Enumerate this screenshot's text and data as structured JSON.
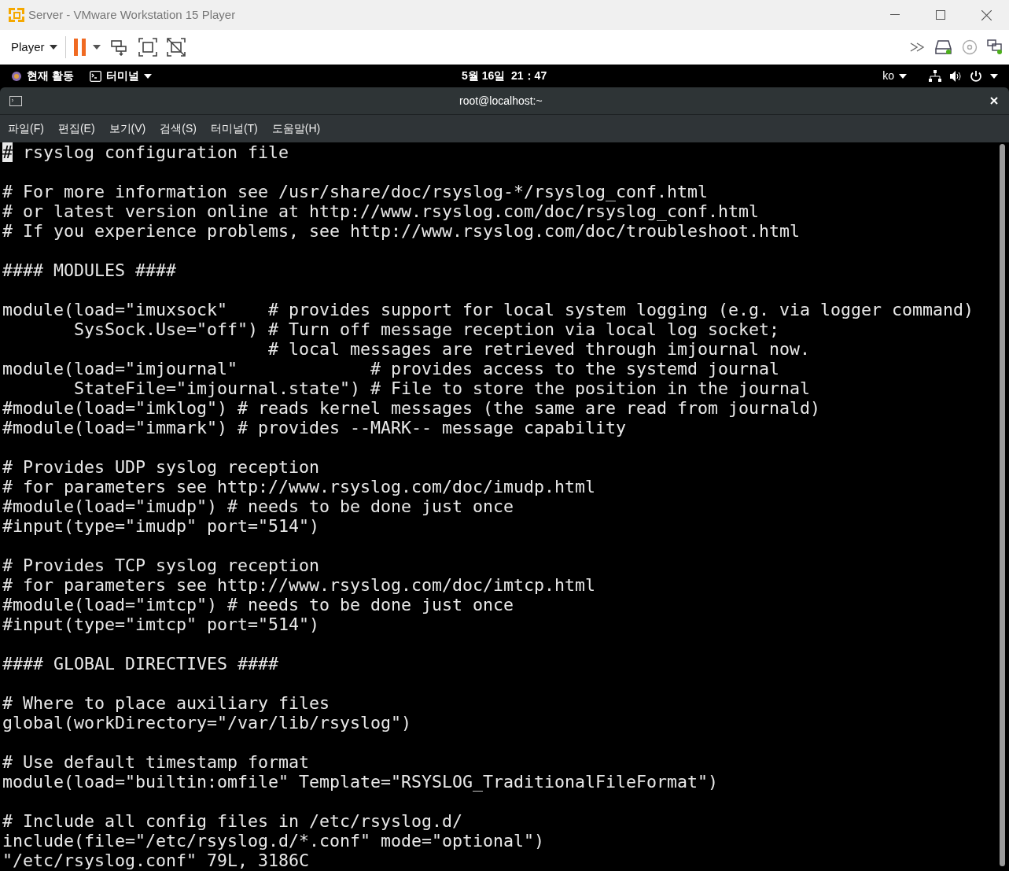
{
  "window": {
    "title": "Server - VMware Workstation 15 Player"
  },
  "toolbar": {
    "player_menu": "Player"
  },
  "top_bar": {
    "activities": "현재 활동",
    "app_menu": "터미널",
    "clock": "5월 16일  21：47",
    "input_source": "ko"
  },
  "terminal": {
    "title": "root@localhost:~",
    "menu": [
      "파일(F)",
      "편집(E)",
      "보기(V)",
      "검색(S)",
      "터미널(T)",
      "도움말(H)"
    ],
    "lines": [
      {
        "kind": "text",
        "cursor": "#",
        "text": " rsyslog configuration file"
      },
      {
        "kind": "blank"
      },
      {
        "kind": "text",
        "text": "# For more information see /usr/share/doc/rsyslog-*/rsyslog_conf.html"
      },
      {
        "kind": "text",
        "text": "# or latest version online at http://www.rsyslog.com/doc/rsyslog_conf.html"
      },
      {
        "kind": "text",
        "text": "# If you experience problems, see http://www.rsyslog.com/doc/troubleshoot.html"
      },
      {
        "kind": "blank"
      },
      {
        "kind": "text",
        "text": "#### MODULES ####"
      },
      {
        "kind": "blank"
      },
      {
        "kind": "text",
        "text": "module(load=\"imuxsock\"    # provides support for local system logging (e.g. via logger command)"
      },
      {
        "kind": "text",
        "text": "       SysSock.Use=\"off\") # Turn off message reception via local log socket;"
      },
      {
        "kind": "text",
        "text": "                          # local messages are retrieved through imjournal now."
      },
      {
        "kind": "text",
        "text": "module(load=\"imjournal\"             # provides access to the systemd journal"
      },
      {
        "kind": "text",
        "text": "       StateFile=\"imjournal.state\") # File to store the position in the journal"
      },
      {
        "kind": "text",
        "text": "#module(load=\"imklog\") # reads kernel messages (the same are read from journald)"
      },
      {
        "kind": "text",
        "text": "#module(load=\"immark\") # provides --MARK-- message capability"
      },
      {
        "kind": "blank"
      },
      {
        "kind": "text",
        "text": "# Provides UDP syslog reception"
      },
      {
        "kind": "text",
        "text": "# for parameters see http://www.rsyslog.com/doc/imudp.html"
      },
      {
        "kind": "text",
        "text": "#module(load=\"imudp\") # needs to be done just once"
      },
      {
        "kind": "text",
        "text": "#input(type=\"imudp\" port=\"514\")"
      },
      {
        "kind": "blank"
      },
      {
        "kind": "text",
        "text": "# Provides TCP syslog reception"
      },
      {
        "kind": "text",
        "text": "# for parameters see http://www.rsyslog.com/doc/imtcp.html"
      },
      {
        "kind": "text",
        "text": "#module(load=\"imtcp\") # needs to be done just once"
      },
      {
        "kind": "text",
        "text": "#input(type=\"imtcp\" port=\"514\")"
      },
      {
        "kind": "blank"
      },
      {
        "kind": "text",
        "text": "#### GLOBAL DIRECTIVES ####"
      },
      {
        "kind": "blank"
      },
      {
        "kind": "text",
        "text": "# Where to place auxiliary files"
      },
      {
        "kind": "text",
        "text": "global(workDirectory=\"/var/lib/rsyslog\")"
      },
      {
        "kind": "blank"
      },
      {
        "kind": "text",
        "text": "# Use default timestamp format"
      },
      {
        "kind": "text",
        "text": "module(load=\"builtin:omfile\" Template=\"RSYSLOG_TraditionalFileFormat\")"
      },
      {
        "kind": "blank"
      },
      {
        "kind": "text",
        "text": "# Include all config files in /etc/rsyslog.d/"
      },
      {
        "kind": "text",
        "text": "include(file=\"/etc/rsyslog.d/*.conf\" mode=\"optional\")"
      },
      {
        "kind": "text",
        "text": "\"/etc/rsyslog.conf\" 79L, 3186C"
      }
    ]
  }
}
